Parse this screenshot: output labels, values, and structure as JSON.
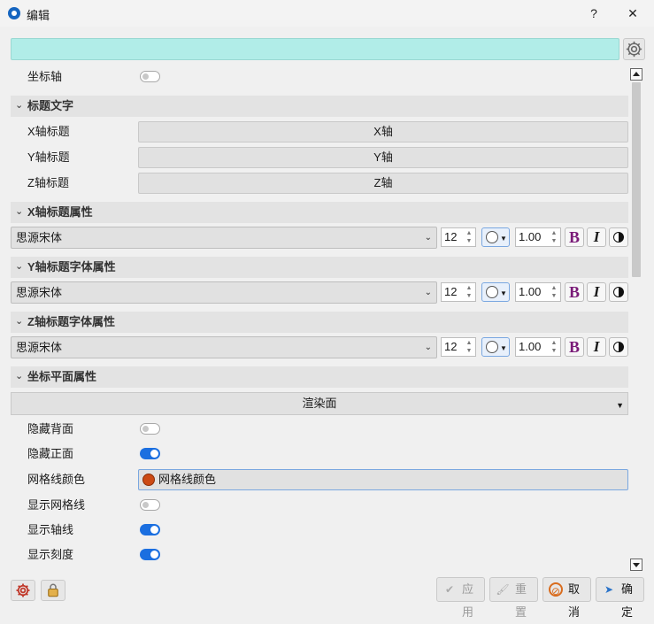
{
  "window": {
    "title": "编辑",
    "help_label": "?",
    "close_label": "✕"
  },
  "icons": {
    "app": "app-logo-icon",
    "gear": "gear-icon",
    "help": "help-icon",
    "close": "close-icon"
  },
  "axis": {
    "label": "坐标轴",
    "on": false
  },
  "title_text": {
    "section_label": "标题文字",
    "x_label": "X轴标题",
    "x_value": "X轴",
    "y_label": "Y轴标题",
    "y_value": "Y轴",
    "z_label": "Z轴标题",
    "z_value": "Z轴"
  },
  "x_title_props": {
    "section_label": "X轴标题属性",
    "font": "思源宋体",
    "size": "12",
    "scale": "1.00"
  },
  "y_title_props": {
    "section_label": "Y轴标题字体属性",
    "font": "思源宋体",
    "size": "12",
    "scale": "1.00"
  },
  "z_title_props": {
    "section_label": "Z轴标题字体属性",
    "font": "思源宋体",
    "size": "12",
    "scale": "1.00"
  },
  "format_buttons": {
    "bold": "B",
    "italic": "I"
  },
  "plane_props": {
    "section_label": "坐标平面属性",
    "render_mode": "渲染面",
    "hide_back": {
      "label": "隐藏背面",
      "on": false
    },
    "hide_front": {
      "label": "隐藏正面",
      "on": true
    },
    "grid_color": {
      "label": "网格线颜色",
      "button": "网格线颜色",
      "color": "#cc4a14"
    },
    "show_grid": {
      "label": "显示网格线",
      "on": false
    },
    "show_axis": {
      "label": "显示轴线",
      "on": true
    },
    "show_ticks": {
      "label": "显示刻度",
      "on": true
    }
  },
  "footer": {
    "apply": "应用",
    "reset": "重置",
    "cancel": "取消",
    "ok": "确定"
  },
  "accent": "#1b6fe0"
}
